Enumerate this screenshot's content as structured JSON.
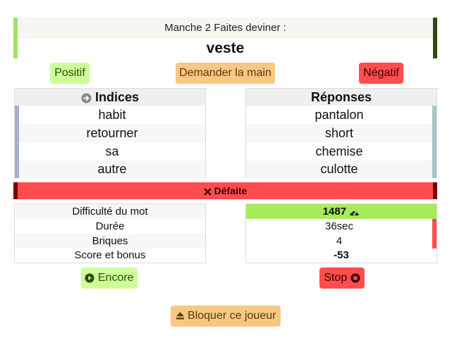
{
  "header": {
    "round_label": "Manche 2 Faites deviner :",
    "word": "veste"
  },
  "actions": {
    "positive": "Positif",
    "ask_hand": "Demander la main",
    "negative": "Négatif"
  },
  "clues": {
    "title": "Indices",
    "items": [
      "habit",
      "retourner",
      "sa",
      "autre"
    ]
  },
  "answers": {
    "title": "Réponses",
    "items": [
      "pantalon",
      "short",
      "chemise",
      "culotte"
    ]
  },
  "result": {
    "label": "Défaite"
  },
  "stats": {
    "labels": [
      "Difficulté du mot",
      "Durée",
      "Briques",
      "Score et bonus"
    ],
    "values": [
      "1487",
      "36sec",
      "4",
      "-53"
    ]
  },
  "controls": {
    "again": "Encore",
    "stop": "Stop",
    "block": "Bloquer ce joueur"
  },
  "colors": {
    "positive": "#ccff99",
    "negative": "#ff4d4d",
    "neutral": "#f7c882"
  }
}
